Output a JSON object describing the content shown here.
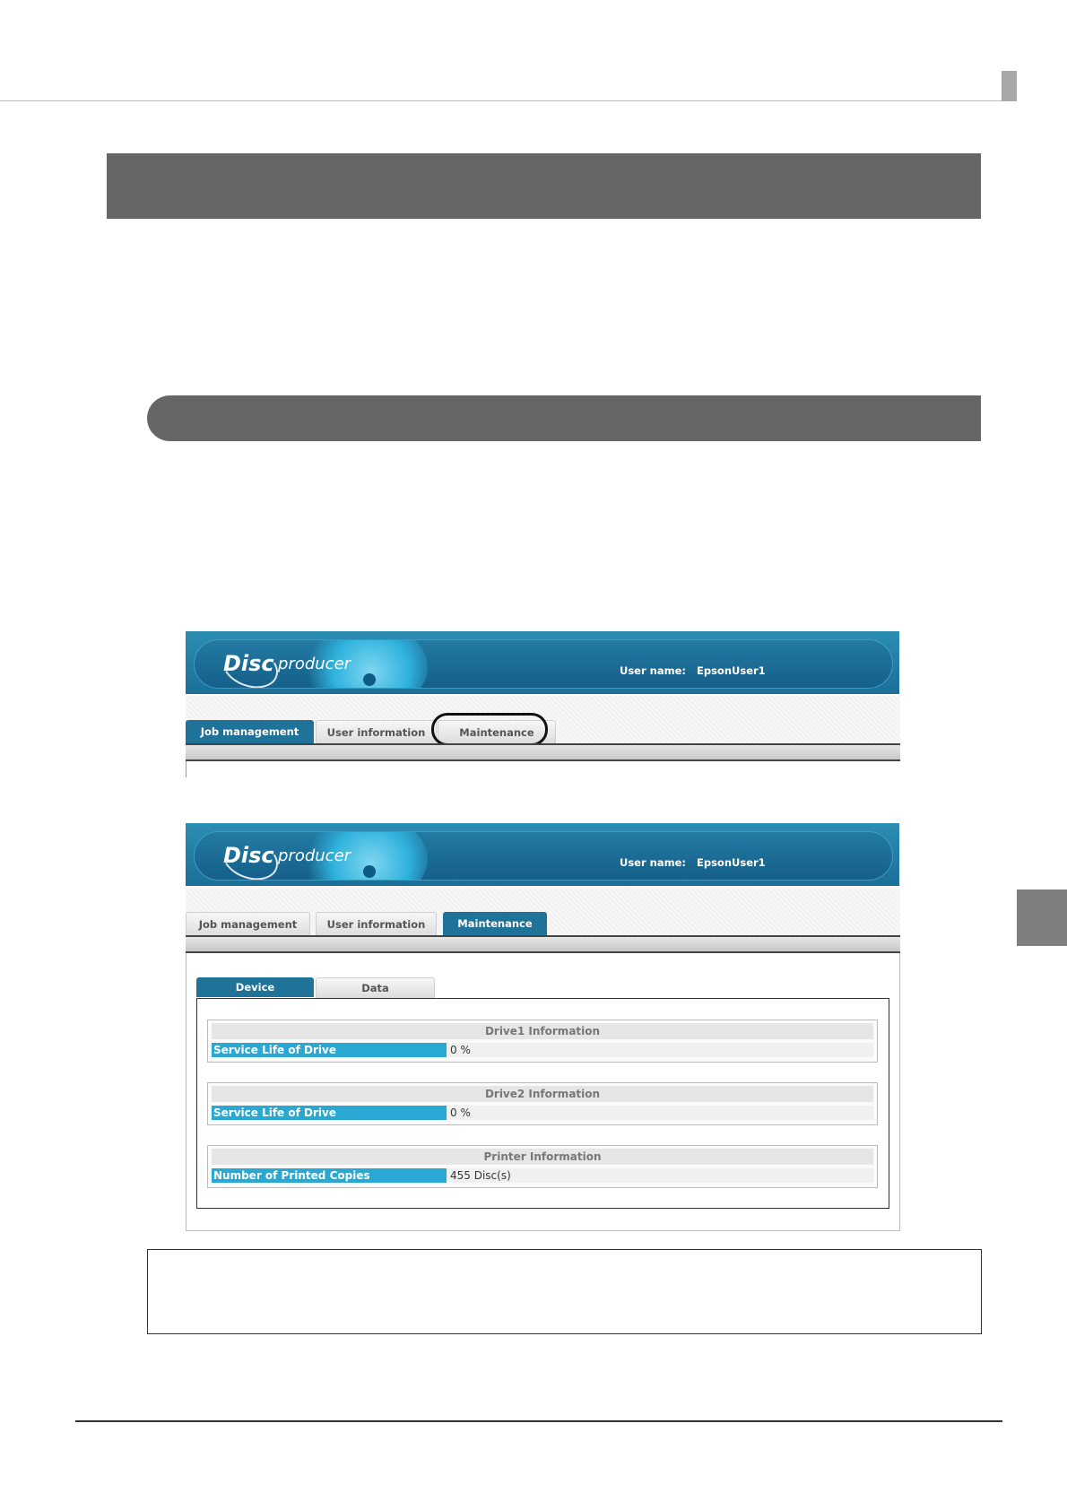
{
  "colors": {
    "section_band": "#666666",
    "brand_blue": "#1f7398",
    "cell_blue": "#29a8d4",
    "side_tab": "#7f7f7f"
  },
  "screenshot_top": {
    "header": {
      "logo_disc": "Disc",
      "logo_producer": "producer",
      "user_label": "User name:",
      "user_value": "EpsonUser1"
    },
    "tabs": [
      {
        "label": "Job management",
        "active": true
      },
      {
        "label": "User information",
        "active": false
      },
      {
        "label": "Maintenance",
        "active": false,
        "highlighted": true
      }
    ]
  },
  "screenshot_bottom": {
    "header": {
      "logo_disc": "Disc",
      "logo_producer": "producer",
      "user_label": "User name:",
      "user_value": "EpsonUser1"
    },
    "tabs": [
      {
        "label": "Job management",
        "active": false
      },
      {
        "label": "User information",
        "active": false
      },
      {
        "label": "Maintenance",
        "active": true
      }
    ],
    "subtabs": [
      {
        "label": "Device",
        "active": true
      },
      {
        "label": "Data",
        "active": false
      }
    ],
    "info_boxes": [
      {
        "title": "Drive1 Information",
        "key": "Service Life of Drive",
        "value": "0 %"
      },
      {
        "title": "Drive2 Information",
        "key": "Service Life of Drive",
        "value": "0 %"
      },
      {
        "title": "Printer Information",
        "key": "Number of Printed Copies",
        "value": "455 Disc(s)"
      }
    ]
  }
}
